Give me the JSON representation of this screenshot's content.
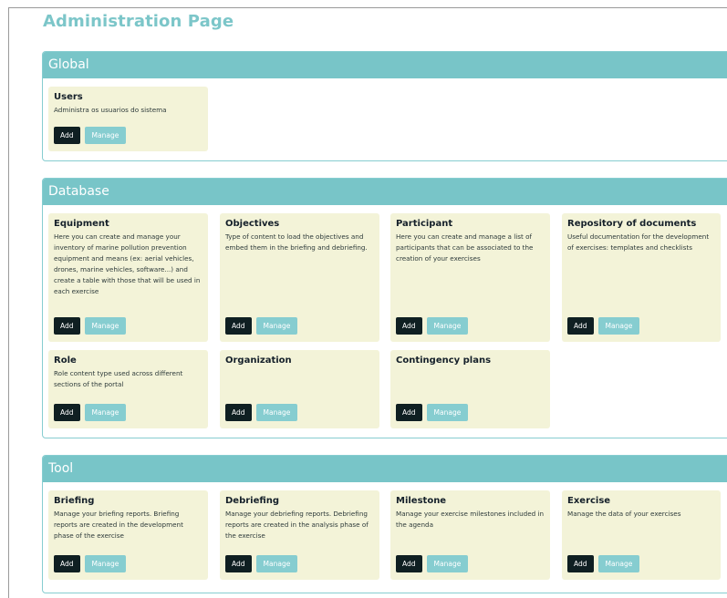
{
  "page": {
    "title": "Administration Page"
  },
  "sections": {
    "global": {
      "title": "Global",
      "cards": [
        {
          "title": "Users",
          "desc": "Administra os usuarios do sistema",
          "add": "Add",
          "manage": "Manage"
        }
      ]
    },
    "database": {
      "title": "Database",
      "cards": [
        {
          "title": "Equipment",
          "desc": "Here you can create and manage your inventory of marine pollution prevention equipment and means (ex: aerial vehicles, drones, marine vehicles, software...) and create a table with those that will be used in each exercise",
          "add": "Add",
          "manage": "Manage"
        },
        {
          "title": "Objectives",
          "desc": "Type of content to load the objectives and embed them in the briefing and debriefing.",
          "add": "Add",
          "manage": "Manage"
        },
        {
          "title": "Participant",
          "desc": "Here you can create and manage a list of participants that can be associated to the creation of your exercises",
          "add": "Add",
          "manage": "Manage"
        },
        {
          "title": "Repository of documents",
          "desc": "Useful documentation for the development of exercises: templates and checklists",
          "add": "Add",
          "manage": "Manage"
        },
        {
          "title": "Role",
          "desc": "Role content type used across different sections of the portal",
          "add": "Add",
          "manage": "Manage"
        },
        {
          "title": "Organization",
          "desc": "",
          "add": "Add",
          "manage": "Manage"
        },
        {
          "title": "Contingency plans",
          "desc": "",
          "add": "Add",
          "manage": "Manage"
        }
      ]
    },
    "tool": {
      "title": "Tool",
      "cards": [
        {
          "title": "Briefing",
          "desc": "Manage your briefing reports. Briefing reports are created in the development phase of the exercise",
          "add": "Add",
          "manage": "Manage"
        },
        {
          "title": "Debriefing",
          "desc": "Manage your debriefing reports. Debriefing reports are created in the analysis phase of the exercise",
          "add": "Add",
          "manage": "Manage"
        },
        {
          "title": "Milestone",
          "desc": "Manage your exercise milestones included in the agenda",
          "add": "Add",
          "manage": "Manage"
        },
        {
          "title": "Exercise",
          "desc": "Manage the data of your exercises",
          "add": "Add",
          "manage": "Manage"
        }
      ]
    }
  }
}
